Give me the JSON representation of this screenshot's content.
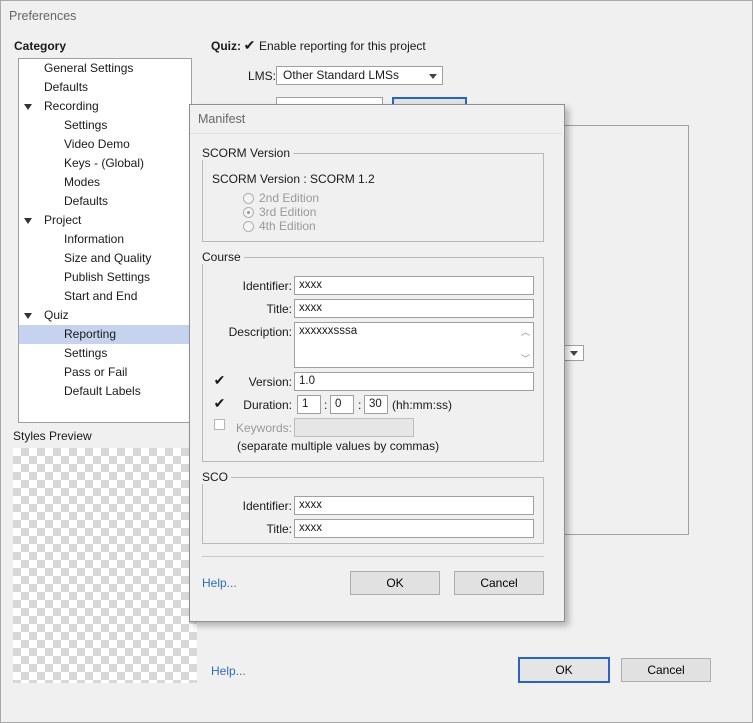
{
  "window": {
    "title": "Preferences"
  },
  "category": {
    "label": "Category",
    "items": [
      {
        "label": "General Settings"
      },
      {
        "label": "Defaults"
      },
      {
        "label": "Recording"
      },
      {
        "label": "Settings"
      },
      {
        "label": "Video Demo"
      },
      {
        "label": "Keys - (Global)"
      },
      {
        "label": "Modes"
      },
      {
        "label": "Defaults"
      },
      {
        "label": "Project"
      },
      {
        "label": "Information"
      },
      {
        "label": "Size and Quality"
      },
      {
        "label": "Publish Settings"
      },
      {
        "label": "Start and End"
      },
      {
        "label": "Quiz"
      },
      {
        "label": "Reporting"
      },
      {
        "label": "Settings"
      },
      {
        "label": "Pass or Fail"
      },
      {
        "label": "Default Labels"
      }
    ],
    "selected": "Reporting"
  },
  "styles_preview": {
    "label": "Styles Preview"
  },
  "quiz": {
    "label": "Quiz:",
    "enable_reporting_label": "Enable reporting for this project",
    "enable_reporting_checked": true,
    "lms_label": "LMS:",
    "lms_value": "Other Standard LMSs"
  },
  "footer": {
    "help_label": "Help...",
    "ok_label": "OK",
    "cancel_label": "Cancel"
  },
  "manifest": {
    "title": "Manifest",
    "scorm": {
      "group_label": "SCORM Version",
      "version_text": "SCORM Version : SCORM 1.2",
      "editions": [
        "2nd Edition",
        "3rd Edition",
        "4th Edition"
      ],
      "selected_edition": "3rd Edition"
    },
    "course": {
      "group_label": "Course",
      "identifier_label": "Identifier:",
      "identifier_value": "xxxx",
      "title_label": "Title:",
      "title_value": "xxxx",
      "description_label": "Description:",
      "description_value": "xxxxxxsssa",
      "version_label": "Version:",
      "version_checked": true,
      "version_value": "1.0",
      "duration_label": "Duration:",
      "duration_checked": true,
      "duration_h": "1",
      "duration_m": "0",
      "duration_s": "30",
      "duration_sep": ":",
      "duration_format": "(hh:mm:ss)",
      "keywords_label": "Keywords:",
      "keywords_checked": false,
      "keywords_value": "",
      "keywords_hint": "(separate multiple values by commas)"
    },
    "sco": {
      "group_label": "SCO",
      "identifier_label": "Identifier:",
      "identifier_value": "xxxx",
      "title_label": "Title:",
      "title_value": "xxxx"
    },
    "help_label": "Help...",
    "ok_label": "OK",
    "cancel_label": "Cancel"
  }
}
